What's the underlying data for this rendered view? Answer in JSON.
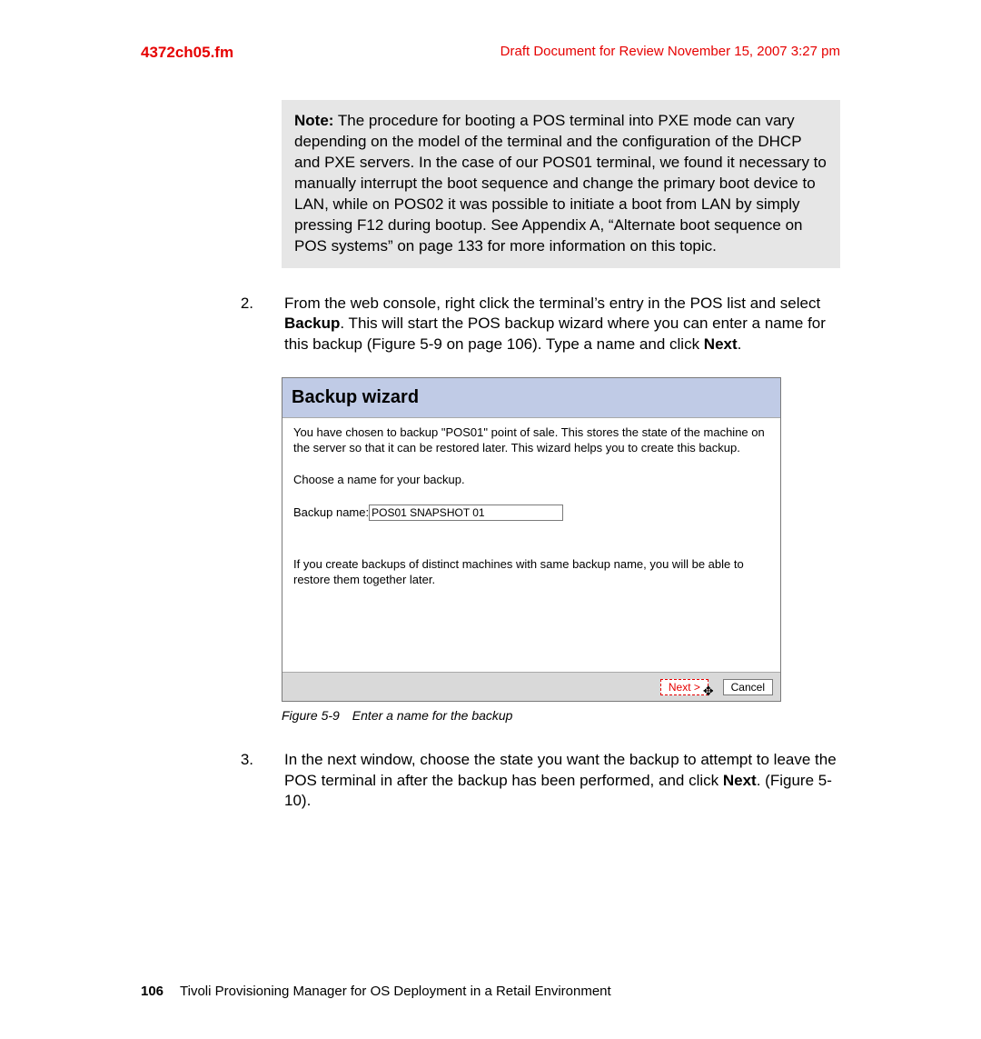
{
  "header": {
    "left": "4372ch05.fm",
    "right": "Draft Document for Review November 15, 2007 3:27 pm"
  },
  "note": {
    "label": "Note:",
    "text": " The procedure for booting a POS terminal into PXE mode can vary depending on the model of the terminal and the configuration of the DHCP and PXE servers. In the case of our POS01 terminal, we found it necessary to manually interrupt the boot sequence and change the primary boot device to LAN, while on POS02 it was possible to initiate a boot from LAN by simply pressing F12 during bootup. See Appendix A, “Alternate boot sequence on POS systems” on page 133 for more information on this topic."
  },
  "step2": {
    "marker": "2.",
    "text_a": "From the web console, right click the terminal’s entry in the POS list and select ",
    "bold_a": "Backup",
    "text_b": ". This will start the POS backup wizard where you can enter a name for this backup (Figure 5-9 on page 106). Type a name and click ",
    "bold_b": "Next",
    "text_c": "."
  },
  "wizard": {
    "title": "Backup wizard",
    "intro": "You have chosen to backup \"POS01\" point of sale. This stores the state of the machine on the server so that it can be restored later. This wizard helps you to create this backup.",
    "choose": "Choose a name for your backup.",
    "label": "Backup name:",
    "value": "POS01 SNAPSHOT 01",
    "tip": "If you create backups of distinct machines with same backup name, you will be able to restore them together later.",
    "next": "Next >",
    "cancel": "Cancel"
  },
  "caption": "Figure 5-9 Enter a name for the backup",
  "step3": {
    "marker": "3.",
    "text_a": "In the next window, choose the state you want the backup to attempt to leave the POS terminal in after the backup has been performed, and click ",
    "bold_a": "Next",
    "text_b": ". (Figure 5-10)."
  },
  "footer": {
    "page": "106",
    "title": "Tivoli Provisioning Manager for OS Deployment in a Retail Environment"
  }
}
